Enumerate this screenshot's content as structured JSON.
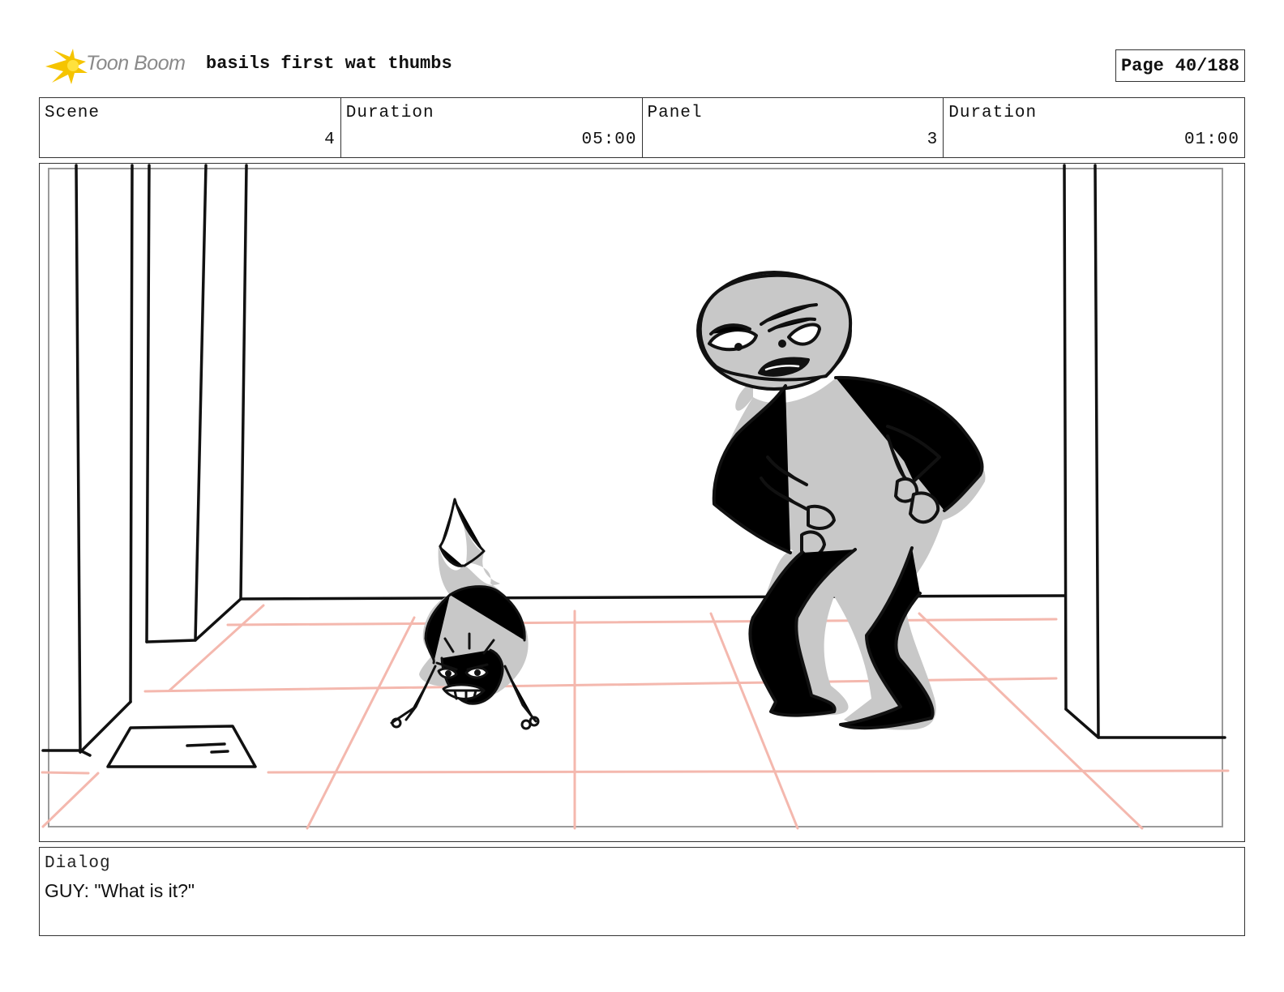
{
  "header": {
    "logo_text": "Toon Boom",
    "project_title": "basils first wat thumbs",
    "page_label": "Page",
    "page_number": "40/188"
  },
  "info": {
    "scene_label": "Scene",
    "scene_value": "4",
    "scene_duration_label": "Duration",
    "scene_duration_value": "05:00",
    "panel_label": "Panel",
    "panel_value": "3",
    "panel_duration_label": "Duration",
    "panel_duration_value": "01:00"
  },
  "dialog": {
    "label": "Dialog",
    "text": "GUY: \"What is it?\""
  },
  "colors": {
    "logo_flare": "#f5c400",
    "floor_grid": "#f4b8ae",
    "character_fill": "#c8c8c8"
  }
}
